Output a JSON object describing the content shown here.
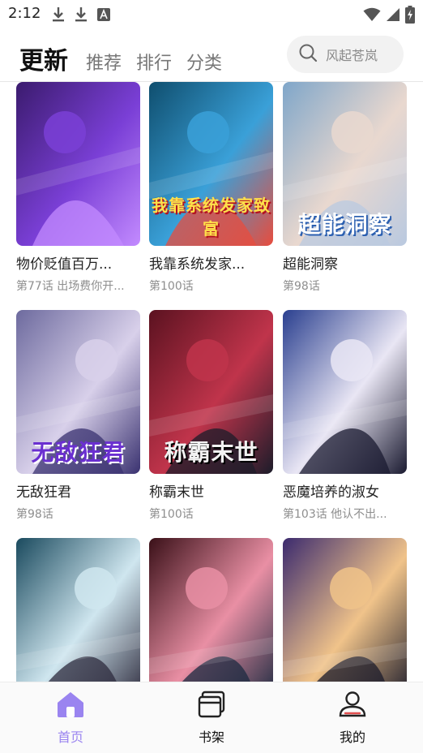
{
  "status_bar": {
    "time": "2:12",
    "left_icons": [
      "download-icon",
      "download-icon",
      "a-app-icon"
    ],
    "right_icons": [
      "wifi-icon",
      "signal-icon",
      "battery-charging-icon"
    ]
  },
  "header": {
    "tabs": [
      {
        "label": "更新",
        "active": true
      },
      {
        "label": "推荐",
        "active": false
      },
      {
        "label": "排行",
        "active": false
      },
      {
        "label": "分类",
        "active": false
      }
    ],
    "search": {
      "placeholder": "风起苍岚",
      "icon": "search-icon"
    }
  },
  "comics": [
    {
      "title": "物价贬值百万...",
      "chapter": "第77话 出场费你开...",
      "logo_text": "",
      "colors": [
        "#3b1b6e",
        "#7a3fd6",
        "#c38bff"
      ]
    },
    {
      "title": "我靠系统发家...",
      "chapter": "第100话",
      "logo_text": "我靠系统发家致富",
      "colors": [
        "#0f4e6e",
        "#3aa0d8",
        "#e84c3d"
      ]
    },
    {
      "title": "超能洞察",
      "chapter": "第98话",
      "logo_text": "超能洞察",
      "colors": [
        "#7fa6c9",
        "#e9d8cf",
        "#b9c9e0"
      ]
    },
    {
      "title": "无敌狂君",
      "chapter": "第98话",
      "logo_text": "无敌狂君",
      "colors": [
        "#6d6a9e",
        "#d8d0ea",
        "#3a3270"
      ]
    },
    {
      "title": "称霸末世",
      "chapter": "第100话",
      "logo_text": "称霸末世",
      "colors": [
        "#5b1220",
        "#c0344b",
        "#1c1c2a"
      ]
    },
    {
      "title": "恶魔培养的淑女",
      "chapter": "第103话 他认不出...",
      "logo_text": "",
      "colors": [
        "#2a3f8f",
        "#e9e6f4",
        "#1a1a30"
      ]
    },
    {
      "title": "",
      "chapter": "",
      "logo_text": "",
      "colors": [
        "#1a4a5e",
        "#cfe6ef",
        "#2e2b3d"
      ]
    },
    {
      "title": "",
      "chapter": "",
      "logo_text": "",
      "colors": [
        "#3a1018",
        "#e98fa4",
        "#1b2a40"
      ]
    },
    {
      "title": "",
      "chapter": "",
      "logo_text": "",
      "colors": [
        "#3b2a6e",
        "#f0c38a",
        "#1b1b2b"
      ]
    }
  ],
  "bottom_nav": [
    {
      "label": "首页",
      "icon": "home-icon",
      "active": true
    },
    {
      "label": "书架",
      "icon": "bookshelf-icon",
      "active": false
    },
    {
      "label": "我的",
      "icon": "profile-icon",
      "active": false
    }
  ]
}
